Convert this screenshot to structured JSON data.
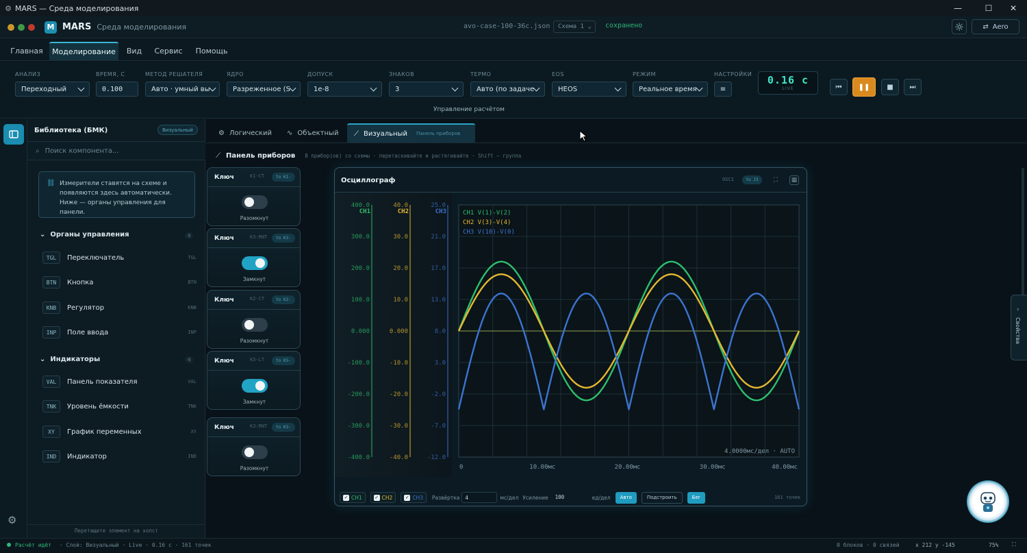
{
  "window": {
    "title": "MARS — Среда моделирования"
  },
  "header": {
    "app_name": "MARS",
    "app_subtitle": "Среда моделирования",
    "logo_letter": "M",
    "filename": "avo-case-100-36c.json",
    "schema_label": "Схема 1",
    "save_status": "сохранено",
    "theme_label": "Aero"
  },
  "menu": {
    "tabs": [
      "Главная",
      "Моделирование",
      "Вид",
      "Сервис",
      "Помощь"
    ],
    "active": "Моделирование"
  },
  "toolbar": {
    "fields": [
      {
        "label": "Анализ",
        "value": "Переходный",
        "type": "select"
      },
      {
        "label": "Время, с",
        "value": "0.100",
        "type": "input"
      },
      {
        "label": "Метод решателя",
        "value": "Авто · умный вы",
        "type": "select"
      },
      {
        "label": "Ядро",
        "value": "Разреженное (S",
        "type": "select"
      },
      {
        "label": "Допуск",
        "value": "1e-8",
        "type": "select"
      },
      {
        "label": "Знаков",
        "value": "3",
        "type": "select"
      },
      {
        "label": "Термо",
        "value": "Авто (по задаче",
        "type": "select"
      },
      {
        "label": "EOS",
        "value": "HEOS",
        "type": "select"
      },
      {
        "label": "Режим",
        "value": "Реальное время",
        "type": "select"
      }
    ],
    "settings_label": "Настройки",
    "timer_value": "0.16 с",
    "timer_status": "LIVE",
    "caption": "Управление расчётом"
  },
  "library": {
    "title": "Библиотека (БМК)",
    "badge": "Визуальный",
    "search_placeholder": "Поиск компонента...",
    "hint": "Измерители ставятся на схеме и появляются здесь автоматически. Ниже — органы управления для панели.",
    "groups": [
      {
        "title": "Органы управления",
        "count": "4",
        "items": [
          {
            "code": "TGL",
            "name": "Переключатель",
            "tag": "TGL"
          },
          {
            "code": "BTN",
            "name": "Кнопка",
            "tag": "BTN"
          },
          {
            "code": "KNB",
            "name": "Регулятор",
            "tag": "KNB"
          },
          {
            "code": "INP",
            "name": "Поле ввода",
            "tag": "INP"
          }
        ]
      },
      {
        "title": "Индикаторы",
        "count": "4",
        "items": [
          {
            "code": "VAL",
            "name": "Панель показателя",
            "tag": "VAL"
          },
          {
            "code": "TNK",
            "name": "Уровень ёмкости",
            "tag": "TNK"
          },
          {
            "code": "XY",
            "name": "График переменных",
            "tag": "XY"
          },
          {
            "code": "IND",
            "name": "Индикатор",
            "tag": "IND"
          }
        ]
      }
    ],
    "drop_hint": "Перетащите элемент на холст"
  },
  "view_tabs": {
    "tabs": [
      "Логический",
      "Объектный",
      "Визуальный"
    ],
    "active": "Визуальный",
    "active_badge": "Панель приборов"
  },
  "panel": {
    "title": "Панель приборов",
    "subtitle": "8 прибор(ов) со схемы · перетаскивайте и растягивайте · Shift — группа"
  },
  "switches": [
    {
      "title": "Ключ",
      "id": "K1-CT",
      "badge": "to K1-",
      "on": false,
      "state": "Разомкнут"
    },
    {
      "title": "Ключ",
      "id": "K3:RNT",
      "badge": "to K3-",
      "on": true,
      "state": "Замкнут"
    },
    {
      "title": "Ключ",
      "id": "K2-CT",
      "badge": "to K2-",
      "on": false,
      "state": "Разомкнут"
    },
    {
      "title": "Ключ",
      "id": "K5-LT",
      "badge": "to K5-",
      "on": true,
      "state": "Замкнут"
    },
    {
      "title": "Ключ",
      "id": "K3:RNT",
      "badge": "to K3-",
      "on": false,
      "state": "Разомкнут"
    }
  ],
  "oscilloscope": {
    "title": "Осциллограф",
    "id": "OSC1",
    "badge": "to J3",
    "timebase": "4.0000мс/дел · AUTO",
    "footer": {
      "channels": [
        "CH1",
        "CH2",
        "CH3"
      ],
      "sweep_label": "Развёртка",
      "sweep_value": "4",
      "sweep_unit": "мс/дел",
      "gain_label": "Усиление",
      "gain_value": "100",
      "gain_unit": "ед/дел",
      "auto_label": "Авто",
      "fit_label": "Подстроить",
      "run_label": "Бег",
      "points": "161 точек"
    }
  },
  "chart_data": {
    "type": "line",
    "x_ticks": [
      "0",
      "10.00мс",
      "20.00мс",
      "30.00мс",
      "40.00мс"
    ],
    "xlim": [
      0,
      40
    ],
    "axes": [
      {
        "name": "CH1",
        "ticks": [
          "400.0",
          "300.0",
          "200.0",
          "100.0",
          "0.000",
          "-100.0",
          "-200.0",
          "-300.0",
          "-400.0"
        ],
        "ylim": [
          -400,
          400
        ],
        "color": "#2ebf6e"
      },
      {
        "name": "CH2",
        "ticks": [
          "40.0",
          "30.0",
          "20.0",
          "10.0",
          "0.000",
          "-10.0",
          "-20.0",
          "-30.0",
          "-40.0"
        ],
        "ylim": [
          -40,
          40
        ],
        "color": "#e6b830"
      },
      {
        "name": "CH3",
        "ticks": [
          "25.0",
          "21.0",
          "17.0",
          "13.0",
          "8.0",
          "3.0",
          "-2.0",
          "-7.0",
          "-12.0"
        ],
        "ylim": [
          -12,
          25
        ],
        "color": "#3c74d0"
      }
    ],
    "series": [
      {
        "name": "CH1 V(1)-V(2)",
        "color": "#2ebf6e",
        "axis": 0,
        "kind": "sine",
        "amplitude": 220,
        "period_ms": 20,
        "offset": 0
      },
      {
        "name": "CH2 V(3)-V(4)",
        "color": "#e6b830",
        "axis": 1,
        "kind": "sine",
        "amplitude": 18,
        "period_ms": 20,
        "offset": 0
      },
      {
        "name": "CH3 V(10)-V(0)",
        "color": "#3c74d0",
        "axis": 2,
        "kind": "abs_sine",
        "amplitude": 17,
        "period_ms": 20,
        "offset": -5
      }
    ],
    "grid": true
  },
  "properties_tab": "Свойства",
  "status": {
    "running": "Расчёт идёт",
    "details": "· Слой: Визуальный · Live · 0.16 с · 161 точек",
    "counts": "0 блоков · 0 связей",
    "coords": "x 212 y -145",
    "zoom": "75%"
  }
}
